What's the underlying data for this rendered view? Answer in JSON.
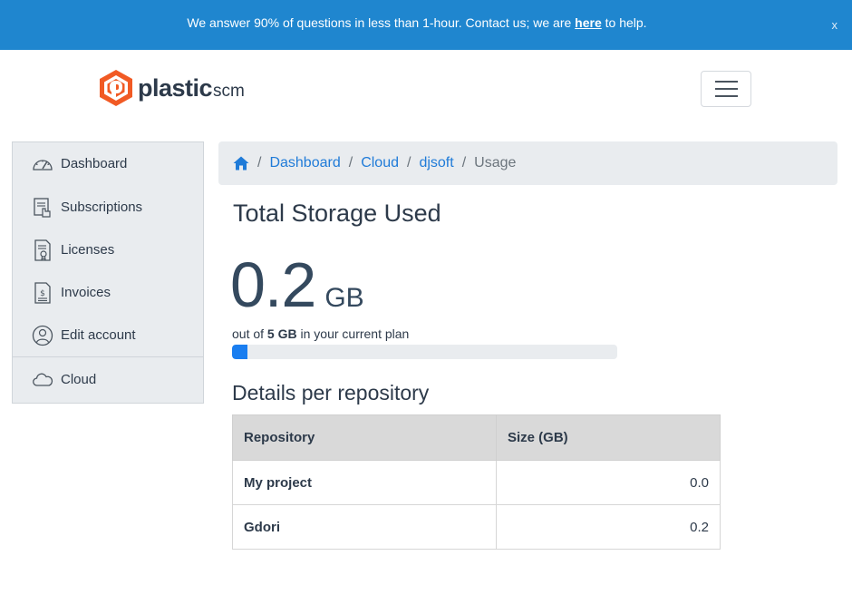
{
  "banner": {
    "text_before": "We answer 90% of questions in less than 1-hour. Contact us; we are ",
    "link": "here",
    "text_after": " to help.",
    "close": "x"
  },
  "logo": {
    "name": "plastic",
    "suffix": "scm"
  },
  "sidebar": {
    "items": [
      {
        "label": "Dashboard",
        "icon": "dashboard-gauge-icon"
      },
      {
        "label": "Subscriptions",
        "icon": "subscriptions-icon"
      },
      {
        "label": "Licenses",
        "icon": "license-certificate-icon"
      },
      {
        "label": "Invoices",
        "icon": "invoice-icon"
      },
      {
        "label": "Edit account",
        "icon": "user-circle-icon"
      },
      {
        "label": "Cloud",
        "icon": "cloud-icon"
      }
    ]
  },
  "breadcrumb": {
    "home_icon": "home-icon",
    "items": [
      "Dashboard",
      "Cloud",
      "djsoft"
    ],
    "current": "Usage",
    "separator": "/"
  },
  "main": {
    "title": "Total Storage Used",
    "used_value": "0.2",
    "used_unit": "GB",
    "note_before": "out of ",
    "plan_size": "5 GB",
    "note_after": " in your current plan",
    "usage_fraction": 0.04,
    "section_title": "Details per repository",
    "table": {
      "headers": [
        "Repository",
        "Size (GB)"
      ],
      "rows": [
        [
          "My project",
          "0.0"
        ],
        [
          "Gdori",
          "0.2"
        ]
      ]
    }
  },
  "colors": {
    "banner": "#1f86cf",
    "link": "#1f7bd8",
    "progress": "#1a7ef0",
    "logo_orange": "#f15a24"
  }
}
